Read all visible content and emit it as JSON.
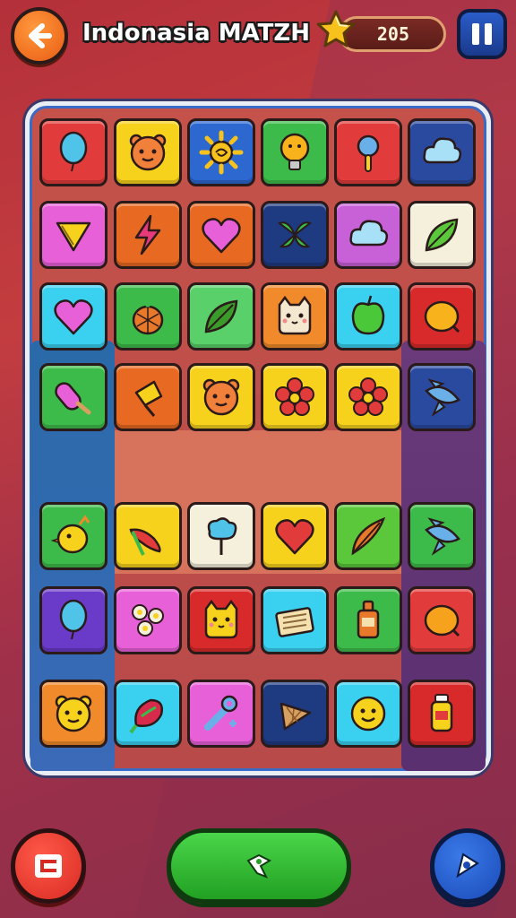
{
  "header": {
    "title": "Indonasia MATZH",
    "score": "205",
    "back_icon": "arrow-left-icon",
    "star_icon": "star-icon",
    "pause_icon": "pause-icon"
  },
  "board": {
    "tiles": [
      {
        "row": 1,
        "col": 1,
        "icon": "balloon-icon",
        "color": "#e23b3b",
        "glyph": "balloon",
        "ic": "#4fc3e8"
      },
      {
        "row": 1,
        "col": 2,
        "icon": "bear-face-icon",
        "color": "#f7d21c",
        "glyph": "bear",
        "ic": "#f0803a"
      },
      {
        "row": 1,
        "col": 3,
        "icon": "sun-icon",
        "color": "#2c68d0",
        "glyph": "sun",
        "ic": "#f7c21c"
      },
      {
        "row": 1,
        "col": 4,
        "icon": "bulb-icon",
        "color": "#3dbb4a",
        "glyph": "bulb",
        "ic": "#f7b21c"
      },
      {
        "row": 1,
        "col": 5,
        "icon": "magnifier-icon",
        "color": "#e23b3b",
        "glyph": "magnifier",
        "ic": "#6ab0e8"
      },
      {
        "row": 1,
        "col": 6,
        "icon": "cloud-icon",
        "color": "#2a4aa0",
        "glyph": "cloud",
        "ic": "#a8e0f7"
      },
      {
        "row": 2,
        "col": 1,
        "icon": "triangle-icon",
        "color": "#e860d8",
        "glyph": "triangle",
        "ic": "#f7d21c"
      },
      {
        "row": 2,
        "col": 2,
        "icon": "lightning-icon",
        "color": "#e86a22",
        "glyph": "lightning",
        "ic": "#e83a7a"
      },
      {
        "row": 2,
        "col": 3,
        "icon": "heart-icon",
        "color": "#e86a22",
        "glyph": "heart",
        "ic": "#e860d8"
      },
      {
        "row": 2,
        "col": 4,
        "icon": "leaves-icon",
        "color": "#1e3a80",
        "glyph": "leaves",
        "ic": "#3dbb4a"
      },
      {
        "row": 2,
        "col": 5,
        "icon": "cloud-icon",
        "color": "#c860d8",
        "glyph": "cloud",
        "ic": "#a8e0f7"
      },
      {
        "row": 2,
        "col": 6,
        "icon": "leaf-icon",
        "color": "#f5f0dc",
        "glyph": "leaf",
        "ic": "#5ac83a"
      },
      {
        "row": 3,
        "col": 1,
        "icon": "heart-icon",
        "color": "#3ad0f0",
        "glyph": "heart",
        "ic": "#e860d8"
      },
      {
        "row": 3,
        "col": 2,
        "icon": "pineapple-icon",
        "color": "#3dbb4a",
        "glyph": "pineapple",
        "ic": "#e8782a"
      },
      {
        "row": 3,
        "col": 3,
        "icon": "leaf-icon",
        "color": "#5ad06a",
        "glyph": "leaf",
        "ic": "#3a9a2a"
      },
      {
        "row": 3,
        "col": 4,
        "icon": "cat-face-icon",
        "color": "#f08a2a",
        "glyph": "cat",
        "ic": "#f5e8d0"
      },
      {
        "row": 3,
        "col": 5,
        "icon": "apple-icon",
        "color": "#3ad0f0",
        "glyph": "apple",
        "ic": "#4ac83a"
      },
      {
        "row": 3,
        "col": 6,
        "icon": "lemon-icon",
        "color": "#d82a2a",
        "glyph": "lemon",
        "ic": "#f7b21c"
      },
      {
        "row": 4,
        "col": 1,
        "icon": "popsicle-icon",
        "color": "#3dbb4a",
        "glyph": "popsicle",
        "ic": "#e860d8"
      },
      {
        "row": 4,
        "col": 2,
        "icon": "candy-icon",
        "color": "#e86a22",
        "glyph": "candy",
        "ic": "#f7d21c"
      },
      {
        "row": 4,
        "col": 3,
        "icon": "bear-face-icon",
        "color": "#f7d21c",
        "glyph": "bear",
        "ic": "#f0803a"
      },
      {
        "row": 4,
        "col": 4,
        "icon": "flower-icon",
        "color": "#f7d21c",
        "glyph": "flower",
        "ic": "#e23b3b"
      },
      {
        "row": 4,
        "col": 5,
        "icon": "flower-icon",
        "color": "#f7d21c",
        "glyph": "flower",
        "ic": "#e23b3b"
      },
      {
        "row": 4,
        "col": 6,
        "icon": "rocket-icon",
        "color": "#2a4aa0",
        "glyph": "rocket",
        "ic": "#6ab0e8"
      },
      {
        "row": 5,
        "col": 1,
        "icon": "chick-icon",
        "color": "#3dbb4a",
        "glyph": "chick",
        "ic": "#f7d21c"
      },
      {
        "row": 5,
        "col": 2,
        "icon": "chili-icon",
        "color": "#f7d21c",
        "glyph": "chili",
        "ic": "#e23b3b"
      },
      {
        "row": 5,
        "col": 3,
        "icon": "cotton-candy-icon",
        "color": "#f5f0dc",
        "glyph": "cotton",
        "ic": "#4fc3e8"
      },
      {
        "row": 5,
        "col": 4,
        "icon": "heart-icon",
        "color": "#f7d21c",
        "glyph": "heart",
        "ic": "#e23b3b"
      },
      {
        "row": 5,
        "col": 5,
        "icon": "feather-icon",
        "color": "#5ac83a",
        "glyph": "feather",
        "ic": "#e8782a"
      },
      {
        "row": 5,
        "col": 6,
        "icon": "rocket-icon",
        "color": "#3dbb4a",
        "glyph": "rocket",
        "ic": "#6ab0e8"
      },
      {
        "row": 6,
        "col": 1,
        "icon": "balloon-icon",
        "color": "#6a3ac8",
        "glyph": "balloon",
        "ic": "#4fc3e8"
      },
      {
        "row": 6,
        "col": 2,
        "icon": "flowers-icon",
        "color": "#e860d8",
        "glyph": "flowers",
        "ic": "#f5f0dc"
      },
      {
        "row": 6,
        "col": 3,
        "icon": "cat-face-icon",
        "color": "#d82a2a",
        "glyph": "cat",
        "ic": "#f7d21c"
      },
      {
        "row": 6,
        "col": 4,
        "icon": "card-icon",
        "color": "#3ad0f0",
        "glyph": "card",
        "ic": "#f5e0b0"
      },
      {
        "row": 6,
        "col": 5,
        "icon": "bottle-icon",
        "color": "#3dbb4a",
        "glyph": "bottle",
        "ic": "#e8782a"
      },
      {
        "row": 6,
        "col": 6,
        "icon": "orange-icon",
        "color": "#e23b3b",
        "glyph": "lemon",
        "ic": "#f7a21c"
      },
      {
        "row": 7,
        "col": 1,
        "icon": "bear-face-icon",
        "color": "#f08a2a",
        "glyph": "bear",
        "ic": "#f7d21c"
      },
      {
        "row": 7,
        "col": 2,
        "icon": "radish-icon",
        "color": "#3ad0f0",
        "glyph": "radish",
        "ic": "#d82a4a"
      },
      {
        "row": 7,
        "col": 3,
        "icon": "wrench-icon",
        "color": "#e860d8",
        "glyph": "wrench",
        "ic": "#6ab0e8"
      },
      {
        "row": 7,
        "col": 4,
        "icon": "ice-cream-cone-icon",
        "color": "#1e3a80",
        "glyph": "cone",
        "ic": "#d8a060"
      },
      {
        "row": 7,
        "col": 5,
        "icon": "smiley-icon",
        "color": "#3ad0f0",
        "glyph": "smiley",
        "ic": "#f7d21c"
      },
      {
        "row": 7,
        "col": 6,
        "icon": "jar-icon",
        "color": "#d82a2a",
        "glyph": "jar",
        "ic": "#f7d21c"
      }
    ]
  },
  "footer": {
    "left_icon": "shuffle-icon",
    "center_icon": "hint-icon",
    "right_icon": "undo-icon"
  }
}
